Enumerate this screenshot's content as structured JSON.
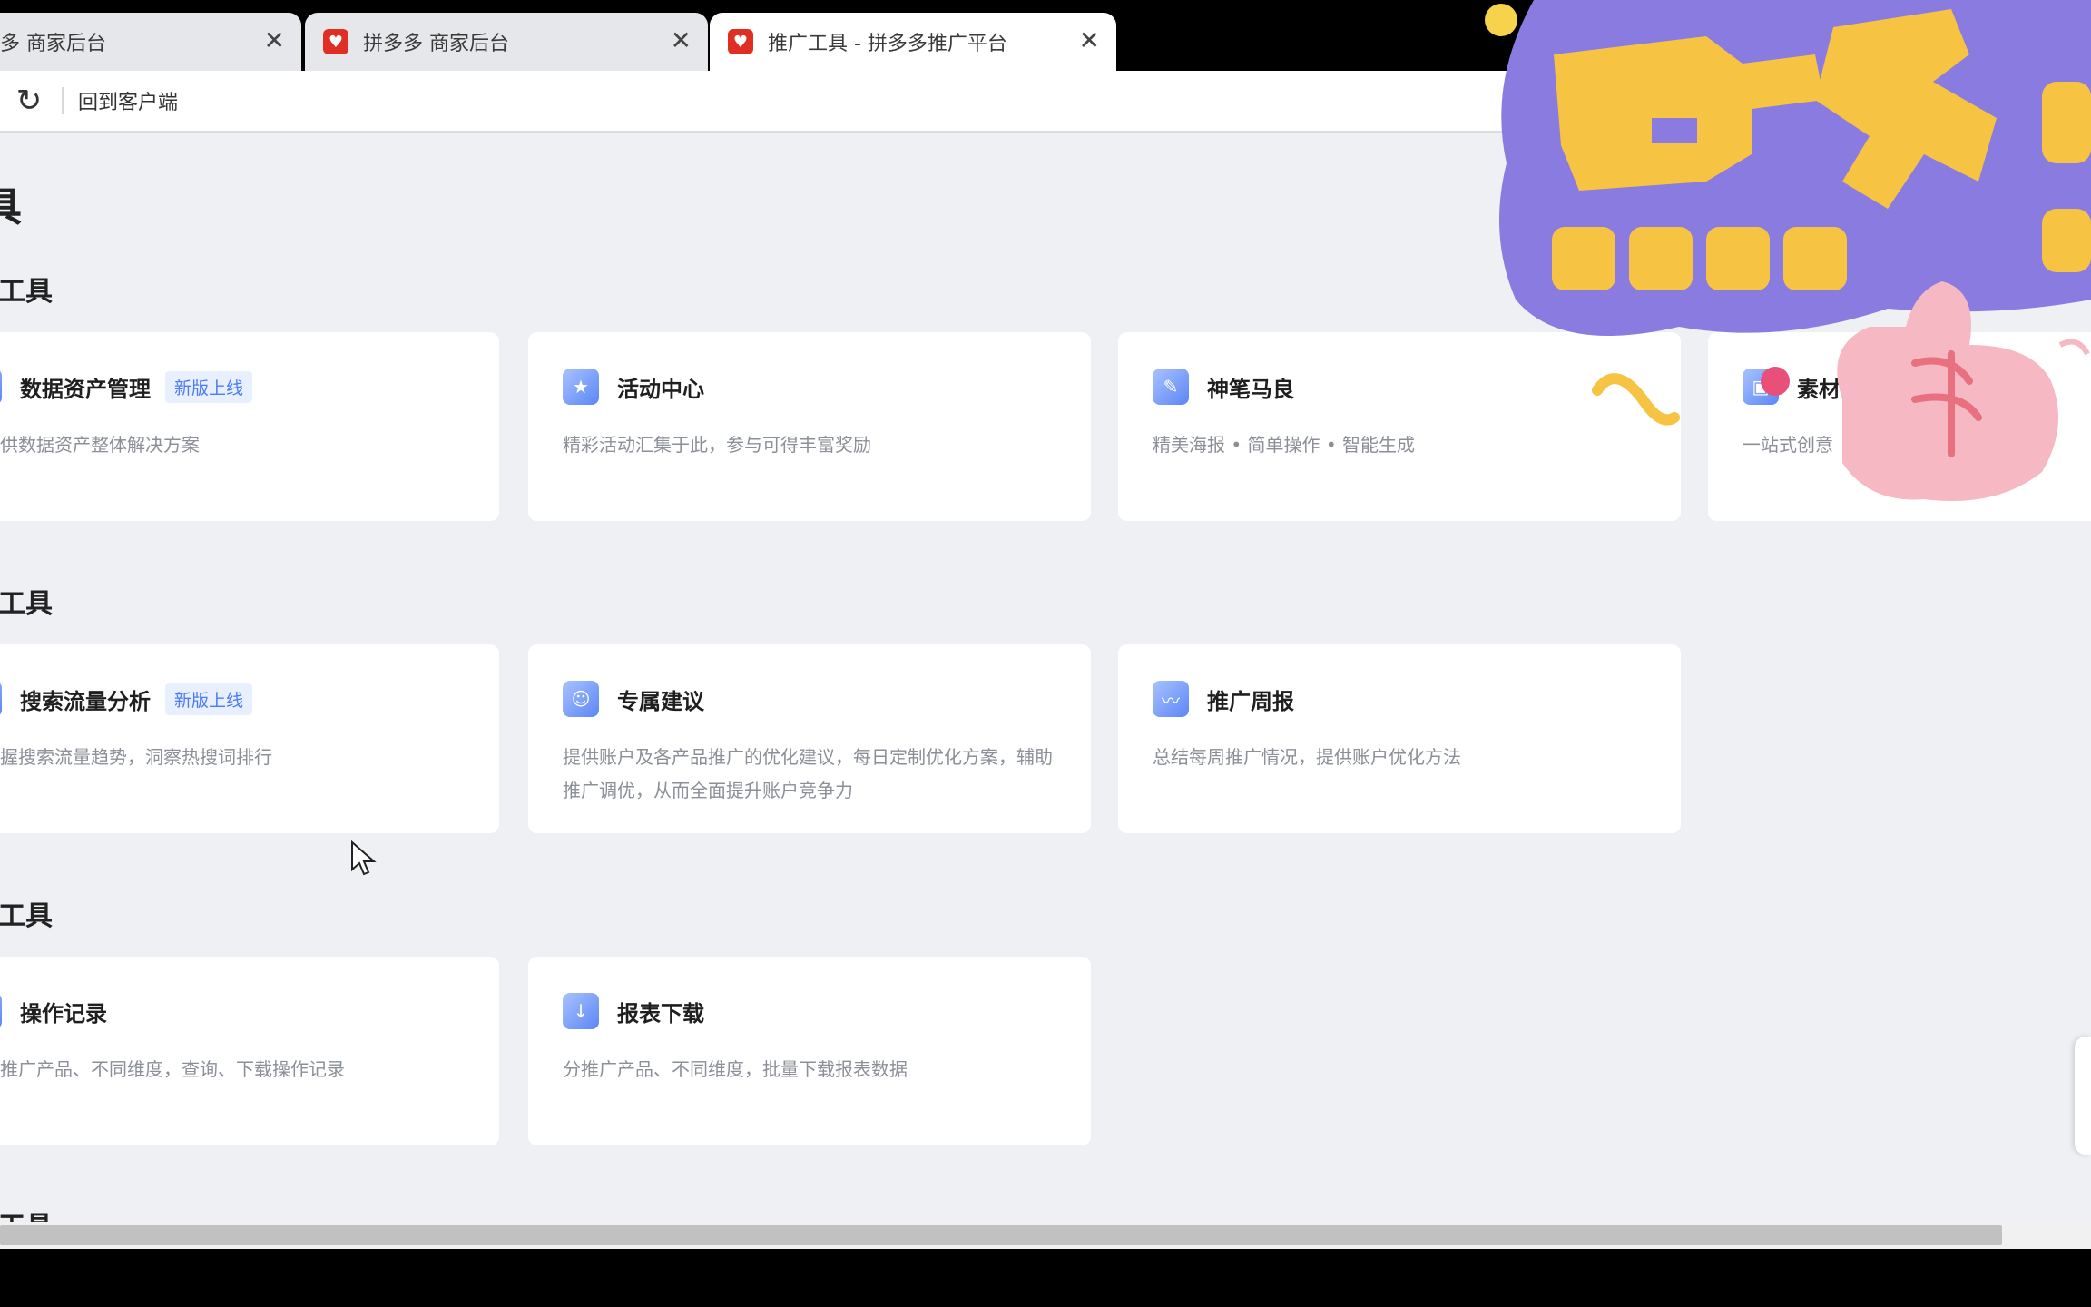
{
  "browser": {
    "tabs": [
      {
        "title": "多 商家后台",
        "active": false
      },
      {
        "title": "拼多多 商家后台",
        "active": false
      },
      {
        "title": "推广工具 - 拼多多推广平台",
        "active": true
      }
    ],
    "close_glyph": "✕",
    "toolbar": {
      "reload_icon": "reload-icon",
      "back_label": "回到客户端"
    }
  },
  "page": {
    "title": "具",
    "sections": [
      {
        "title": "工具",
        "cards": [
          {
            "name": "数据资产管理",
            "badge": "新版上线",
            "desc": "供数据资产整体解决方案",
            "icon": "database-icon"
          },
          {
            "name": "活动中心",
            "desc": "精彩活动汇集于此，参与可得丰富奖励",
            "icon": "flag-icon"
          },
          {
            "name": "神笔马良",
            "desc": "精美海报 • 简单操作 • 智能生成",
            "icon": "brush-icon"
          },
          {
            "name": "素材",
            "desc": "一站式创意",
            "icon": "image-icon"
          }
        ]
      },
      {
        "title": "工具",
        "cards": [
          {
            "name": "搜索流量分析",
            "badge": "新版上线",
            "desc": "握搜索流量趋势，洞察热搜词排行",
            "icon": "search-icon"
          },
          {
            "name": "专属建议",
            "desc": "提供账户及各产品推广的优化建议，每日定制优化方案，辅助推广调优，从而全面提升账户竞争力",
            "icon": "robot-icon"
          },
          {
            "name": "推广周报",
            "desc": "总结每周推广情况，提供账户优化方法",
            "icon": "calendar-chart-icon"
          }
        ]
      },
      {
        "title": "工具",
        "cards": [
          {
            "name": "操作记录",
            "desc": "推广产品、不同维度，查询、下载操作记录",
            "icon": "record-icon"
          },
          {
            "name": "报表下载",
            "desc": "分推广产品、不同维度，批量下载报表数据",
            "icon": "download-icon"
          }
        ]
      },
      {
        "title": "工具"
      }
    ]
  },
  "overlay": {
    "sticker_text": "点关注",
    "colors": {
      "sticker_fill": "#f6c343",
      "sticker_outline": "#8a7be0",
      "thumb": "#f6b8c3"
    }
  },
  "colors": {
    "accent": "#4a7bf7",
    "brand_red": "#e02e24",
    "page_bg": "#eef0f4"
  }
}
